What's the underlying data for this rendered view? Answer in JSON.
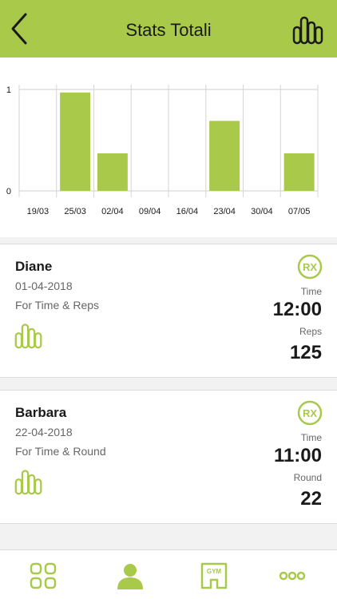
{
  "colors": {
    "accent": "#a8c94a",
    "text": "#1a1a1a",
    "muted": "#666666",
    "background": "#f2f2f2"
  },
  "header": {
    "title": "Stats Totali",
    "back_icon": "chevron-left-icon",
    "logo_icon": "app-logo-icon"
  },
  "chart_data": {
    "type": "bar",
    "categories": [
      "19/03",
      "25/03",
      "02/04",
      "09/04",
      "16/04",
      "23/04",
      "30/04",
      "07/05"
    ],
    "values": [
      0,
      0.97,
      0.37,
      0,
      0,
      0.69,
      0,
      0.37
    ],
    "ylim": [
      0,
      1
    ],
    "yticks": [
      "0",
      "1"
    ],
    "color": "#a8c94a",
    "grid": true
  },
  "workouts": [
    {
      "name": "Diane",
      "date": "01-04-2018",
      "type": "For Time & Reps",
      "badge": "RX",
      "stat1_label": "Time",
      "stat1_value": "12:00",
      "stat2_label": "Reps",
      "stat2_value": "125"
    },
    {
      "name": "Barbara",
      "date": "22-04-2018",
      "type": "For Time & Round",
      "badge": "RX",
      "stat1_label": "Time",
      "stat1_value": "11:00",
      "stat2_label": "Round",
      "stat2_value": "22"
    }
  ],
  "tabbar": {
    "items": [
      {
        "icon": "grid-icon"
      },
      {
        "icon": "profile-icon",
        "active": true
      },
      {
        "icon": "gym-icon",
        "text": "GYM"
      },
      {
        "icon": "more-icon"
      }
    ]
  }
}
